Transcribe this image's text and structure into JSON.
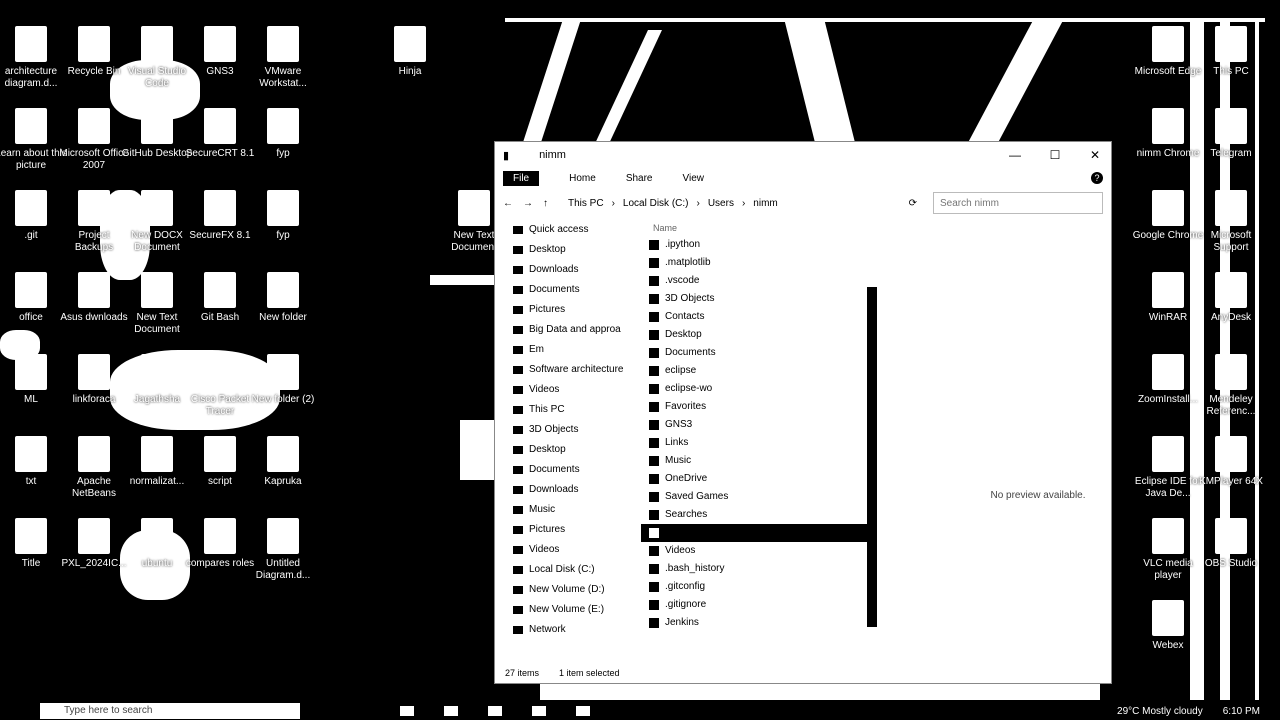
{
  "desktop_left": [
    {
      "label": "architecture diagram.d...",
      "icon": "document-icon"
    },
    {
      "label": "Recycle Bin",
      "icon": "recycle-bin-icon"
    },
    {
      "label": "Visual Studio Code",
      "icon": "vscode-icon"
    },
    {
      "label": "GNS3",
      "icon": "gns3-icon"
    },
    {
      "label": "VMware Workstat...",
      "icon": "vmware-icon"
    },
    {
      "label": "Learn about this picture",
      "icon": "info-icon"
    },
    {
      "label": "Microsoft Office 2007",
      "icon": "folder-icon"
    },
    {
      "label": "GitHub Desktop",
      "icon": "github-icon"
    },
    {
      "label": "SecureCRT 8.1",
      "icon": "securecrt-icon"
    },
    {
      "label": "fyp",
      "icon": "pdf-icon"
    },
    {
      "label": ".git",
      "icon": "document-icon"
    },
    {
      "label": "Project Backups",
      "icon": "folder-icon"
    },
    {
      "label": "New DOCX Document",
      "icon": "document-icon"
    },
    {
      "label": "SecureFX 8.1",
      "icon": "securefx-icon"
    },
    {
      "label": "fyp",
      "icon": "word-icon"
    },
    {
      "label": "office",
      "icon": "document-icon"
    },
    {
      "label": "Asus dwnloads",
      "icon": "folder-icon"
    },
    {
      "label": "New Text Document",
      "icon": "text-document-icon"
    },
    {
      "label": "Git Bash",
      "icon": "git-bash-icon"
    },
    {
      "label": "New folder",
      "icon": "folder-icon"
    },
    {
      "label": "ML",
      "icon": "folder-icon"
    },
    {
      "label": "linkforaca",
      "icon": "document-icon"
    },
    {
      "label": "Jagathsha",
      "icon": "word-icon"
    },
    {
      "label": "Cisco Packet Tracer",
      "icon": "packet-tracer-icon"
    },
    {
      "label": "New folder (2)",
      "icon": "folder-icon"
    },
    {
      "label": "txt",
      "icon": "text-document-icon"
    },
    {
      "label": "Apache NetBeans",
      "icon": "netbeans-icon"
    },
    {
      "label": "normalizat...",
      "icon": "document-icon"
    },
    {
      "label": "script",
      "icon": "document-icon"
    },
    {
      "label": "Kapruka",
      "icon": "document-icon"
    },
    {
      "label": "Title",
      "icon": "document-icon"
    },
    {
      "label": "PXL_2024IC...",
      "icon": "image-icon"
    },
    {
      "label": "ubuntu",
      "icon": "document-icon"
    },
    {
      "label": "compares roles",
      "icon": "document-icon"
    },
    {
      "label": "Untitled Diagram.d...",
      "icon": "document-icon"
    }
  ],
  "desktop_mid": [
    {
      "label": "Hinja",
      "icon": "document-icon"
    },
    {
      "label": "New Text Document",
      "icon": "text-document-icon"
    }
  ],
  "desktop_right": [
    {
      "label": "Microsoft Edge",
      "icon": "edge-icon"
    },
    {
      "label": "This PC",
      "icon": "this-pc-icon"
    },
    {
      "label": "nimm Chrome",
      "icon": "chrome-icon"
    },
    {
      "label": "Telegram",
      "icon": "telegram-icon"
    },
    {
      "label": "Google Chrome",
      "icon": "chrome-icon"
    },
    {
      "label": "Microsoft Support",
      "icon": "help-icon"
    },
    {
      "label": "WinRAR",
      "icon": "winrar-icon"
    },
    {
      "label": "AnyDesk",
      "icon": "anydesk-icon"
    },
    {
      "label": "ZoomInstall...",
      "icon": "zoom-icon"
    },
    {
      "label": "Mendeley Referenc...",
      "icon": "mendeley-icon"
    },
    {
      "label": "Eclipse IDE for Java De...",
      "icon": "eclipse-icon"
    },
    {
      "label": "KMPlayer 64X",
      "icon": "kmplayer-icon"
    },
    {
      "label": "VLC media player",
      "icon": "vlc-icon"
    },
    {
      "label": "OBS Studio",
      "icon": "obs-icon"
    },
    {
      "label": "Webex",
      "icon": "webex-icon"
    }
  ],
  "explorer": {
    "title": "nimm",
    "ribbon": [
      "File",
      "Home",
      "Share",
      "View"
    ],
    "path": [
      "This PC",
      "Local Disk (C:)",
      "Users",
      "nimm"
    ],
    "search_placeholder": "Search nimm",
    "col_name": "Name",
    "nav": [
      {
        "label": "Quick access"
      },
      {
        "label": "Desktop"
      },
      {
        "label": "Downloads"
      },
      {
        "label": "Documents"
      },
      {
        "label": "Pictures"
      },
      {
        "label": "Big Data and approa"
      },
      {
        "label": "Em"
      },
      {
        "label": "Software architecture"
      },
      {
        "label": "Videos"
      },
      {
        "label": "This PC"
      },
      {
        "label": "3D Objects"
      },
      {
        "label": "Desktop"
      },
      {
        "label": "Documents"
      },
      {
        "label": "Downloads"
      },
      {
        "label": "Music"
      },
      {
        "label": "Pictures"
      },
      {
        "label": "Videos"
      },
      {
        "label": "Local Disk (C:)"
      },
      {
        "label": "New Volume (D:)"
      },
      {
        "label": "New Volume (E:)"
      },
      {
        "label": "Network"
      }
    ],
    "files": [
      {
        "name": ".ipython",
        "sel": false
      },
      {
        "name": ".matplotlib",
        "sel": false
      },
      {
        "name": ".vscode",
        "sel": false
      },
      {
        "name": "3D Objects",
        "sel": false
      },
      {
        "name": "Contacts",
        "sel": false
      },
      {
        "name": "Desktop",
        "sel": false
      },
      {
        "name": "Documents",
        "sel": false
      },
      {
        "name": "eclipse",
        "sel": false
      },
      {
        "name": "eclipse-wo",
        "sel": false
      },
      {
        "name": "Favorites",
        "sel": false
      },
      {
        "name": "GNS3",
        "sel": false
      },
      {
        "name": "Links",
        "sel": false
      },
      {
        "name": "Music",
        "sel": false
      },
      {
        "name": "OneDrive",
        "sel": false
      },
      {
        "name": "Saved Games",
        "sel": false
      },
      {
        "name": "Searches",
        "sel": false
      },
      {
        "name": "",
        "sel": true
      },
      {
        "name": "Videos",
        "sel": false
      },
      {
        "name": ".bash_history",
        "sel": false
      },
      {
        "name": ".gitconfig",
        "sel": false
      },
      {
        "name": ".gitignore",
        "sel": false
      },
      {
        "name": "Jenkins",
        "sel": false
      }
    ],
    "preview_text": "No preview available.",
    "status_count": "27 items",
    "status_selected": "1 item selected"
  },
  "taskbar": {
    "search_placeholder": "Type here to search",
    "weather": "29°C  Mostly cloudy",
    "time": "6:10 PM"
  }
}
